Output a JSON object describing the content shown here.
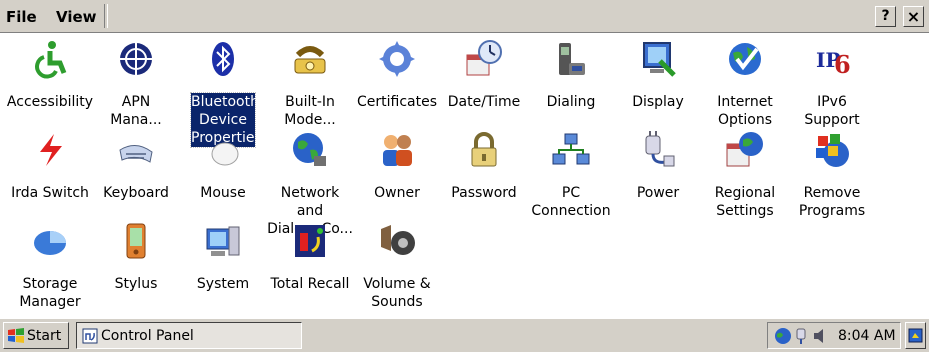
{
  "menubar": {
    "file_label": "File",
    "view_label": "View",
    "help_label": "?",
    "close_label": "×"
  },
  "items": [
    {
      "label": "Accessibility",
      "icon": "accessibility-icon"
    },
    {
      "label": "APN\nMana...",
      "icon": "apn-icon"
    },
    {
      "label": "Bluetooth\nDevice\nProperties",
      "icon": "bluetooth-icon",
      "selected": true
    },
    {
      "label": "Built-In\nMode...",
      "icon": "phone-modem-icon"
    },
    {
      "label": "Certificates",
      "icon": "certificates-icon"
    },
    {
      "label": "Date/Time",
      "icon": "clock-calendar-icon"
    },
    {
      "label": "Dialing",
      "icon": "dialing-icon"
    },
    {
      "label": "Display",
      "icon": "display-icon"
    },
    {
      "label": "Internet\nOptions",
      "icon": "globe-check-icon"
    },
    {
      "label": "IPv6\nSupport",
      "icon": "ipv6-icon"
    },
    {
      "label": "Irda Switch",
      "icon": "irda-icon"
    },
    {
      "label": "Keyboard",
      "icon": "keyboard-icon"
    },
    {
      "label": "Mouse",
      "icon": "mouse-icon"
    },
    {
      "label": "Network and\nDial-up Co...",
      "icon": "network-globe-icon"
    },
    {
      "label": "Owner",
      "icon": "owner-icon"
    },
    {
      "label": "Password",
      "icon": "password-lock-icon"
    },
    {
      "label": "PC\nConnection",
      "icon": "pc-connection-icon"
    },
    {
      "label": "Power",
      "icon": "power-plug-icon"
    },
    {
      "label": "Regional\nSettings",
      "icon": "regional-settings-icon"
    },
    {
      "label": "Remove\nPrograms",
      "icon": "remove-programs-icon"
    },
    {
      "label": "Storage\nManager",
      "icon": "storage-icon"
    },
    {
      "label": "Stylus",
      "icon": "stylus-icon"
    },
    {
      "label": "System",
      "icon": "system-icon"
    },
    {
      "label": "Total Recall",
      "icon": "total-recall-icon"
    },
    {
      "label": "Volume &\nSounds",
      "icon": "speaker-icon"
    }
  ],
  "taskbar": {
    "start_label": "Start",
    "task_label": "Control Panel",
    "time": "8:04 AM"
  },
  "colors": {
    "selection": "#0a246a",
    "chrome": "#d4d0c8"
  }
}
